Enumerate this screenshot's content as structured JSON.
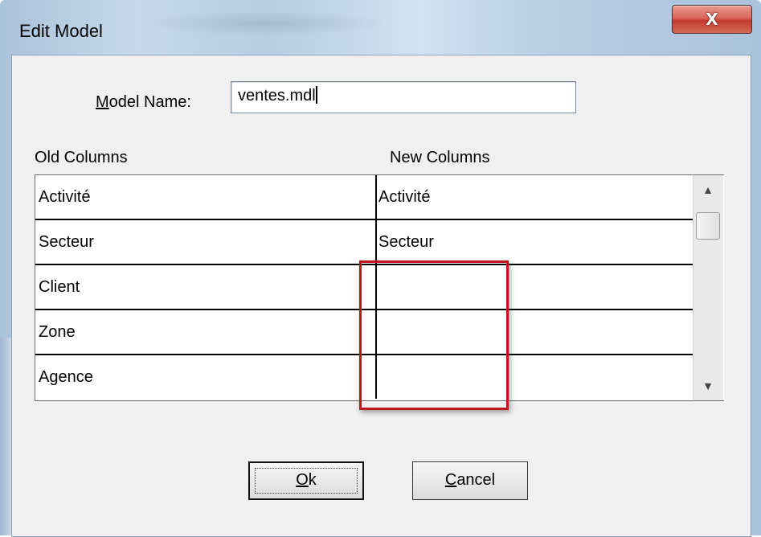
{
  "window": {
    "title": "Edit Model",
    "close_label": "X"
  },
  "form": {
    "model_name_label_prefix": "M",
    "model_name_label_rest": "odel Name:",
    "model_name_value": "ventes.mdl"
  },
  "grid": {
    "old_header": "Old Columns",
    "new_header": "New Columns",
    "rows": [
      {
        "old": "Activité",
        "new": "Activité"
      },
      {
        "old": "Secteur",
        "new": "Secteur"
      },
      {
        "old": "Client",
        "new": ""
      },
      {
        "old": "Zone",
        "new": ""
      },
      {
        "old": "Agence",
        "new": ""
      }
    ]
  },
  "scrollbar": {
    "up_icon": "up-arrow-icon",
    "down_icon": "down-arrow-icon"
  },
  "buttons": {
    "ok_prefix": "O",
    "ok_rest": "k",
    "cancel_prefix": "C",
    "cancel_rest": "ancel"
  },
  "colors": {
    "highlight": "#c0141c",
    "close_button": "#c13a2f"
  }
}
